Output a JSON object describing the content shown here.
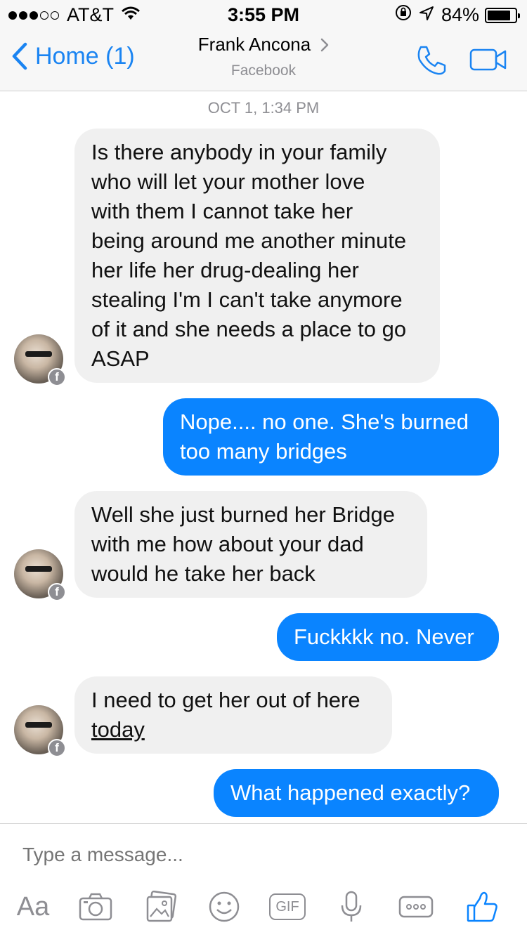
{
  "status_bar": {
    "carrier": "AT&T",
    "time": "3:55 PM",
    "battery": "84%",
    "battery_level": 0.84,
    "signal_bars_filled": 3,
    "signal_bars_total": 5
  },
  "header": {
    "back_label": "Home (1)",
    "contact_name": "Frank Ancona",
    "subtitle": "Facebook"
  },
  "conversation": {
    "timestamp": "OCT 1, 1:34 PM",
    "messages": [
      {
        "from": "contact",
        "lines": [
          "Is there anybody in your family",
          "who will let your mother love",
          "with them I cannot take her",
          "being around me another minute",
          "her life her drug-dealing her",
          "stealing I'm I can't take anymore",
          "of it and she needs a place to go",
          "ASAP"
        ]
      },
      {
        "from": "me",
        "lines": [
          "Nope.... no one. She's burned",
          "too many bridges"
        ]
      },
      {
        "from": "contact",
        "lines": [
          "Well she just burned her Bridge",
          "with me how about your dad",
          "would he take her back"
        ]
      },
      {
        "from": "me",
        "lines": [
          "Fuckkkk no. Never"
        ]
      },
      {
        "from": "contact",
        "lines": [
          "I need to get her out of here",
          "today"
        ]
      },
      {
        "from": "me",
        "lines": [
          "What happened exactly?"
        ]
      }
    ]
  },
  "composer": {
    "placeholder": "Type a message...",
    "text_format_label": "Aa",
    "gif_label": "GIF",
    "icons": [
      "camera-icon",
      "photo-icon",
      "emoji-icon",
      "gif-icon",
      "microphone-icon",
      "more-icon",
      "like-icon"
    ]
  },
  "colors": {
    "accent": "#0a84ff",
    "incoming_bubble": "#f0f0f0",
    "muted_text": "#8e8e93"
  }
}
